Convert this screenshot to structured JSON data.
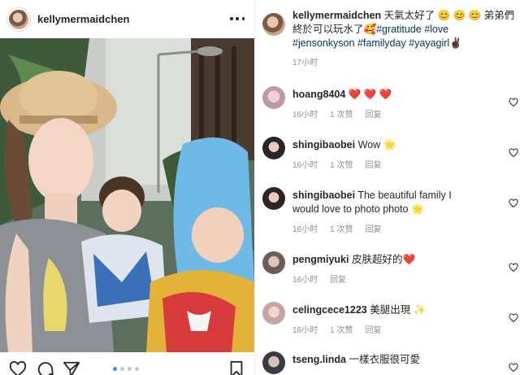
{
  "post": {
    "username": "kellymermaidchen",
    "more_label": "more-options",
    "carousel_index": 1,
    "carousel_count": 4
  },
  "caption": {
    "username": "kellymermaidchen",
    "text_part1": " 天氣太好了 ",
    "emoji1": "😊 😊 😊",
    "text_part2": " 弟弟們",
    "line2_text": "終於可以玩水了",
    "line2_emoji": "🥰",
    "hashtags": [
      "#gratitude",
      "#love",
      "#jensonkyson",
      "#familyday",
      "#yayagirl"
    ],
    "line3_emoji": "✌🏿",
    "time": "17小时"
  },
  "comments": [
    {
      "username": "hoang8404",
      "text": " ❤️ ❤️ ❤️",
      "time": "16小时",
      "likes": "1 次赞",
      "reply": "回复"
    },
    {
      "username": "shingibaobei",
      "text": " Wow 🌟",
      "time": "16小时",
      "likes": "1 次赞",
      "reply": "回复"
    },
    {
      "username": "shingibaobei",
      "text_line1": " The beautiful family I",
      "text_line2": "would love to photo photo 🌟",
      "time": "16小时",
      "likes": "1 次赞",
      "reply": "回复"
    },
    {
      "username": "pengmiyuki",
      "text": " 皮肤超好的❤️",
      "time": "16小时",
      "reply": "回复"
    },
    {
      "username": "celingcece1223",
      "text": " 美腿出現 ✨",
      "time": "16小时",
      "likes": "1 次赞",
      "reply": "回复"
    },
    {
      "username": "tseng.linda",
      "text": " 一樣衣服很可愛"
    }
  ],
  "colors": {
    "link": "#003569",
    "meta": "#8e8e8e",
    "carousel_active": "#3897f0",
    "heart_red": "#ed4956"
  }
}
